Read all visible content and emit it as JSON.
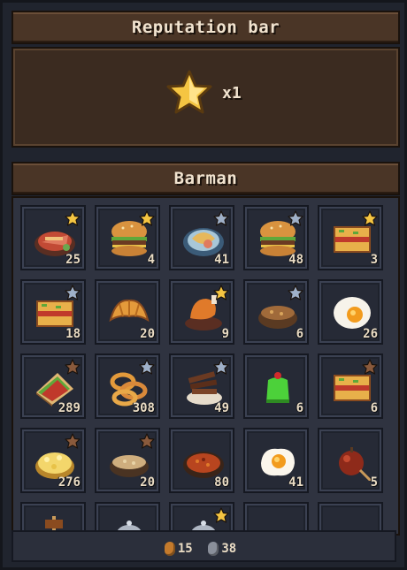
{
  "reputation": {
    "title": "Reputation bar",
    "multiplier": "x1"
  },
  "barman": {
    "title": "Barman",
    "items": [
      {
        "food": "grilled-fish-plate",
        "count": "25",
        "star": "gold"
      },
      {
        "food": "burger",
        "count": "4",
        "star": "gold"
      },
      {
        "food": "seafood-plate",
        "count": "41",
        "star": "silver"
      },
      {
        "food": "burger",
        "count": "48",
        "star": "silver"
      },
      {
        "food": "lasagna",
        "count": "3",
        "star": "gold"
      },
      {
        "food": "lasagna",
        "count": "18",
        "star": "silver"
      },
      {
        "food": "croissant",
        "count": "20",
        "star": "none"
      },
      {
        "food": "roast-chicken-leg",
        "count": "9",
        "star": "gold"
      },
      {
        "food": "soup-bowl",
        "count": "6",
        "star": "silver"
      },
      {
        "food": "boiled-egg",
        "count": "26",
        "star": "none"
      },
      {
        "food": "sandwich",
        "count": "289",
        "star": "bronze"
      },
      {
        "food": "onion-rings",
        "count": "308",
        "star": "silver"
      },
      {
        "food": "steak-strips",
        "count": "49",
        "star": "silver"
      },
      {
        "food": "green-jelly",
        "count": "6",
        "star": "none"
      },
      {
        "food": "lasagna",
        "count": "6",
        "star": "bronze"
      },
      {
        "food": "cheese-pile",
        "count": "276",
        "star": "bronze"
      },
      {
        "food": "porridge-bowl",
        "count": "20",
        "star": "bronze"
      },
      {
        "food": "chili-plate",
        "count": "80",
        "star": "none"
      },
      {
        "food": "fried-egg",
        "count": "41",
        "star": "none"
      },
      {
        "food": "candy-apple",
        "count": "5",
        "star": "none"
      },
      {
        "food": "kebab",
        "count": "",
        "star": "none"
      },
      {
        "food": "covered-dish",
        "count": "",
        "star": "none"
      },
      {
        "food": "covered-dish",
        "count": "",
        "star": "gold"
      },
      {
        "food": "empty",
        "count": "",
        "star": "none"
      },
      {
        "food": "empty",
        "count": "",
        "star": "none"
      }
    ]
  },
  "footer": {
    "bronze_amount": "15",
    "silver_amount": "38"
  },
  "colors": {
    "gold_star": "#f5c542",
    "silver_star": "#9fb0c8",
    "bronze_star": "#8a5a3c",
    "panel_brown": "#3a2a1f",
    "slot_bg": "#262a36"
  }
}
